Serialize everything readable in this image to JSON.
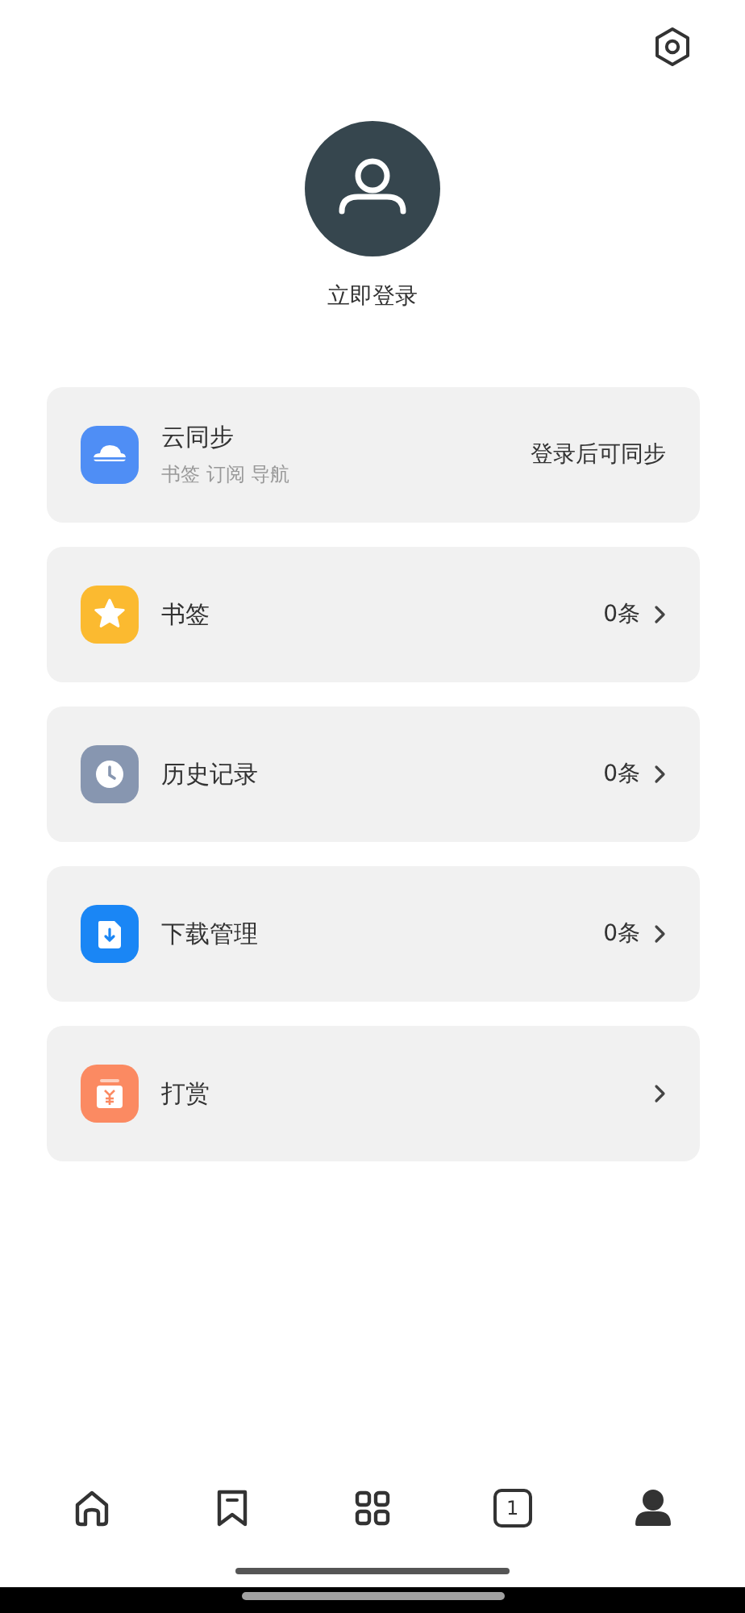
{
  "profile": {
    "login_label": "立即登录"
  },
  "menu": [
    {
      "kind": "cloud",
      "title": "云同步",
      "subtitle": "书签 订阅 导航",
      "value": "登录后可同步",
      "arrow": false
    },
    {
      "kind": "star",
      "title": "书签",
      "value": "0条",
      "arrow": true
    },
    {
      "kind": "clock",
      "title": "历史记录",
      "value": "0条",
      "arrow": true
    },
    {
      "kind": "download",
      "title": "下载管理",
      "value": "0条",
      "arrow": true
    },
    {
      "kind": "gift",
      "title": "打赏",
      "arrow": true
    }
  ],
  "bottom_nav": [
    {
      "kind": "home",
      "selected": false
    },
    {
      "kind": "bookmark",
      "selected": false
    },
    {
      "kind": "grid",
      "selected": false
    },
    {
      "kind": "tabs",
      "count": "1",
      "selected": false
    },
    {
      "kind": "profile",
      "selected": true
    }
  ]
}
